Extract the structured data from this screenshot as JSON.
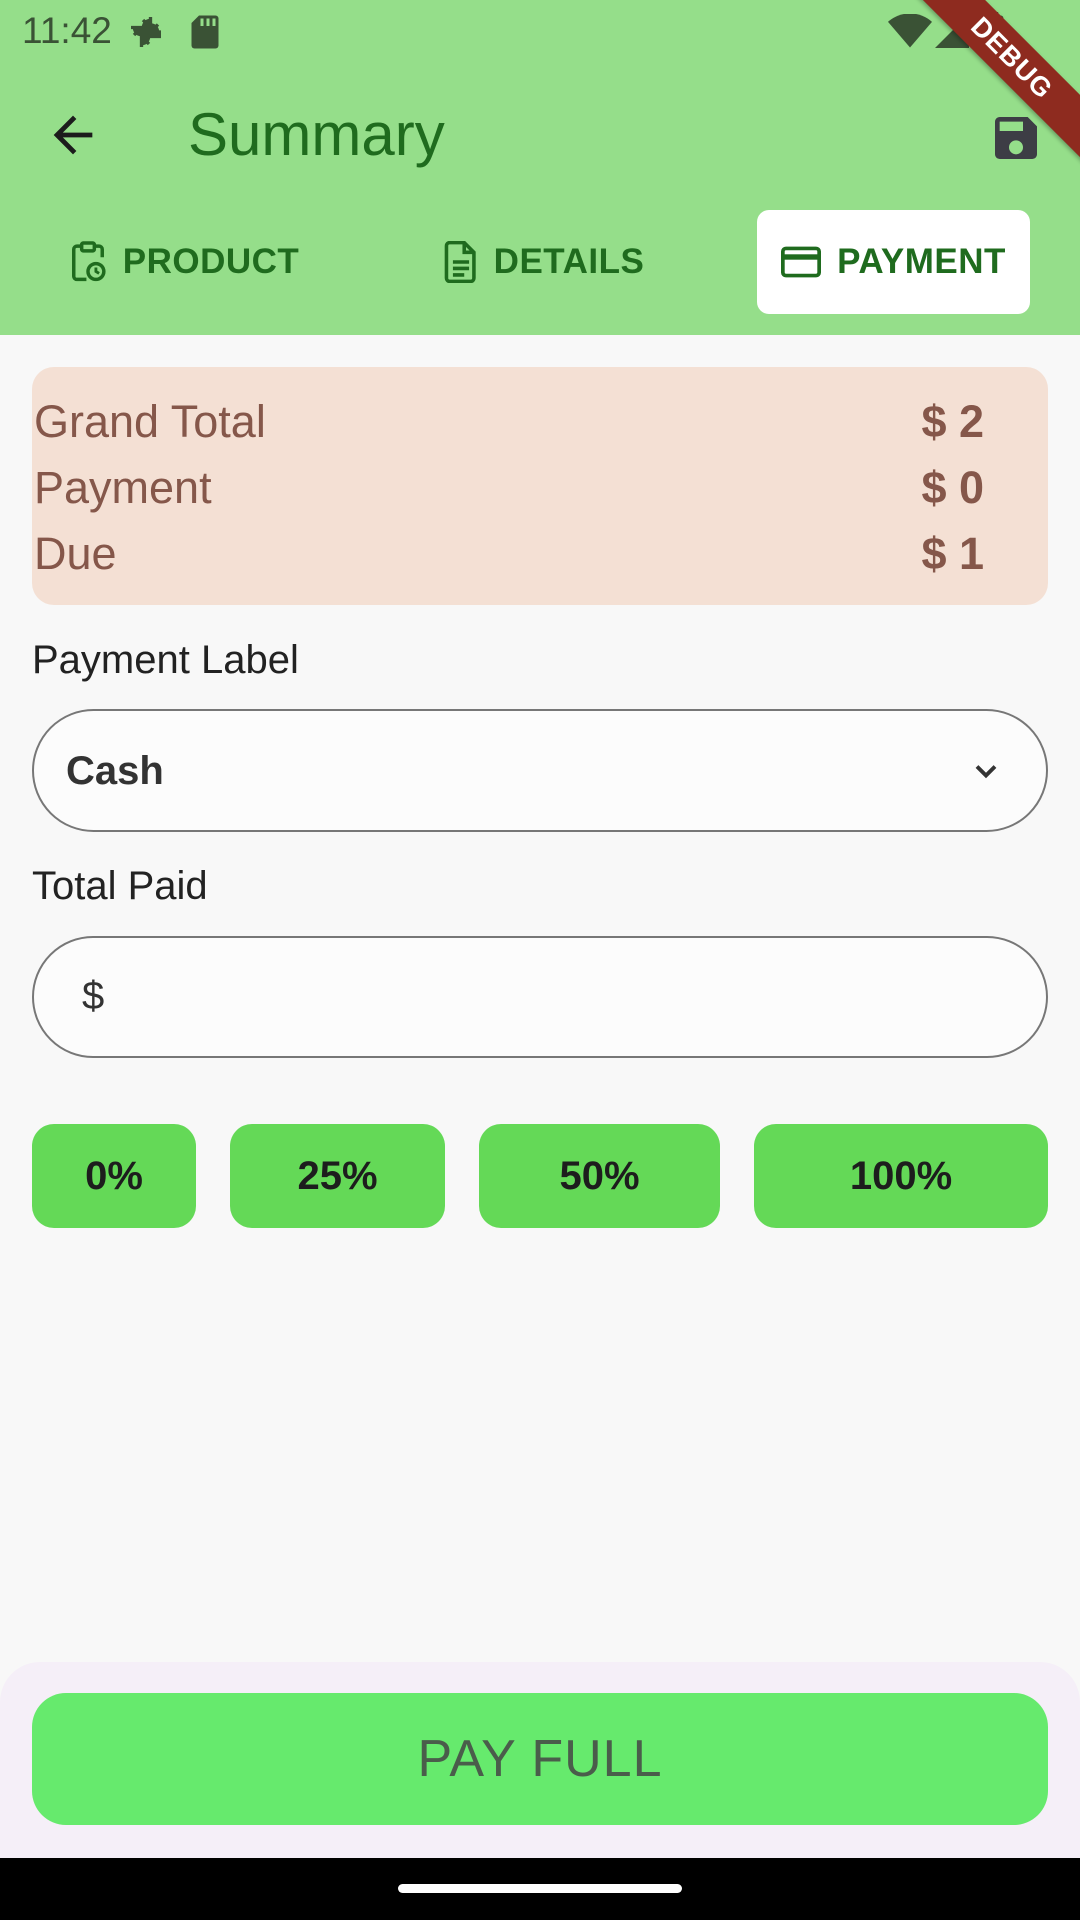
{
  "status_bar": {
    "time": "11:42"
  },
  "debug_banner": "DEBUG",
  "app_bar": {
    "title": "Summary"
  },
  "tabs": [
    {
      "label": "PRODUCT",
      "icon": "clipboard-clock-icon"
    },
    {
      "label": "DETAILS",
      "icon": "document-icon"
    },
    {
      "label": "PAYMENT",
      "icon": "credit-card-icon",
      "selected": true
    }
  ],
  "summary": {
    "grand_total_label": "Grand Total",
    "grand_total_value": "$ 2",
    "payment_label": "Payment",
    "payment_value": "$ 0",
    "due_label": "Due",
    "due_value": "$ 1"
  },
  "form": {
    "payment_label_title": "Payment Label",
    "payment_label_value": "Cash",
    "total_paid_title": "Total Paid",
    "total_paid_prefix": "$",
    "total_paid_value": ""
  },
  "percent_buttons": [
    "0%",
    "25%",
    "50%",
    "100%"
  ],
  "pay_full_label": "PAY FULL",
  "colors": {
    "app_bar": "#95de8a",
    "title_green": "#1f6b1e",
    "summary_card": "#f4e0d4",
    "summary_text": "#85574a",
    "percent_button": "#64d957",
    "pay_full_button": "#66ea6d"
  }
}
